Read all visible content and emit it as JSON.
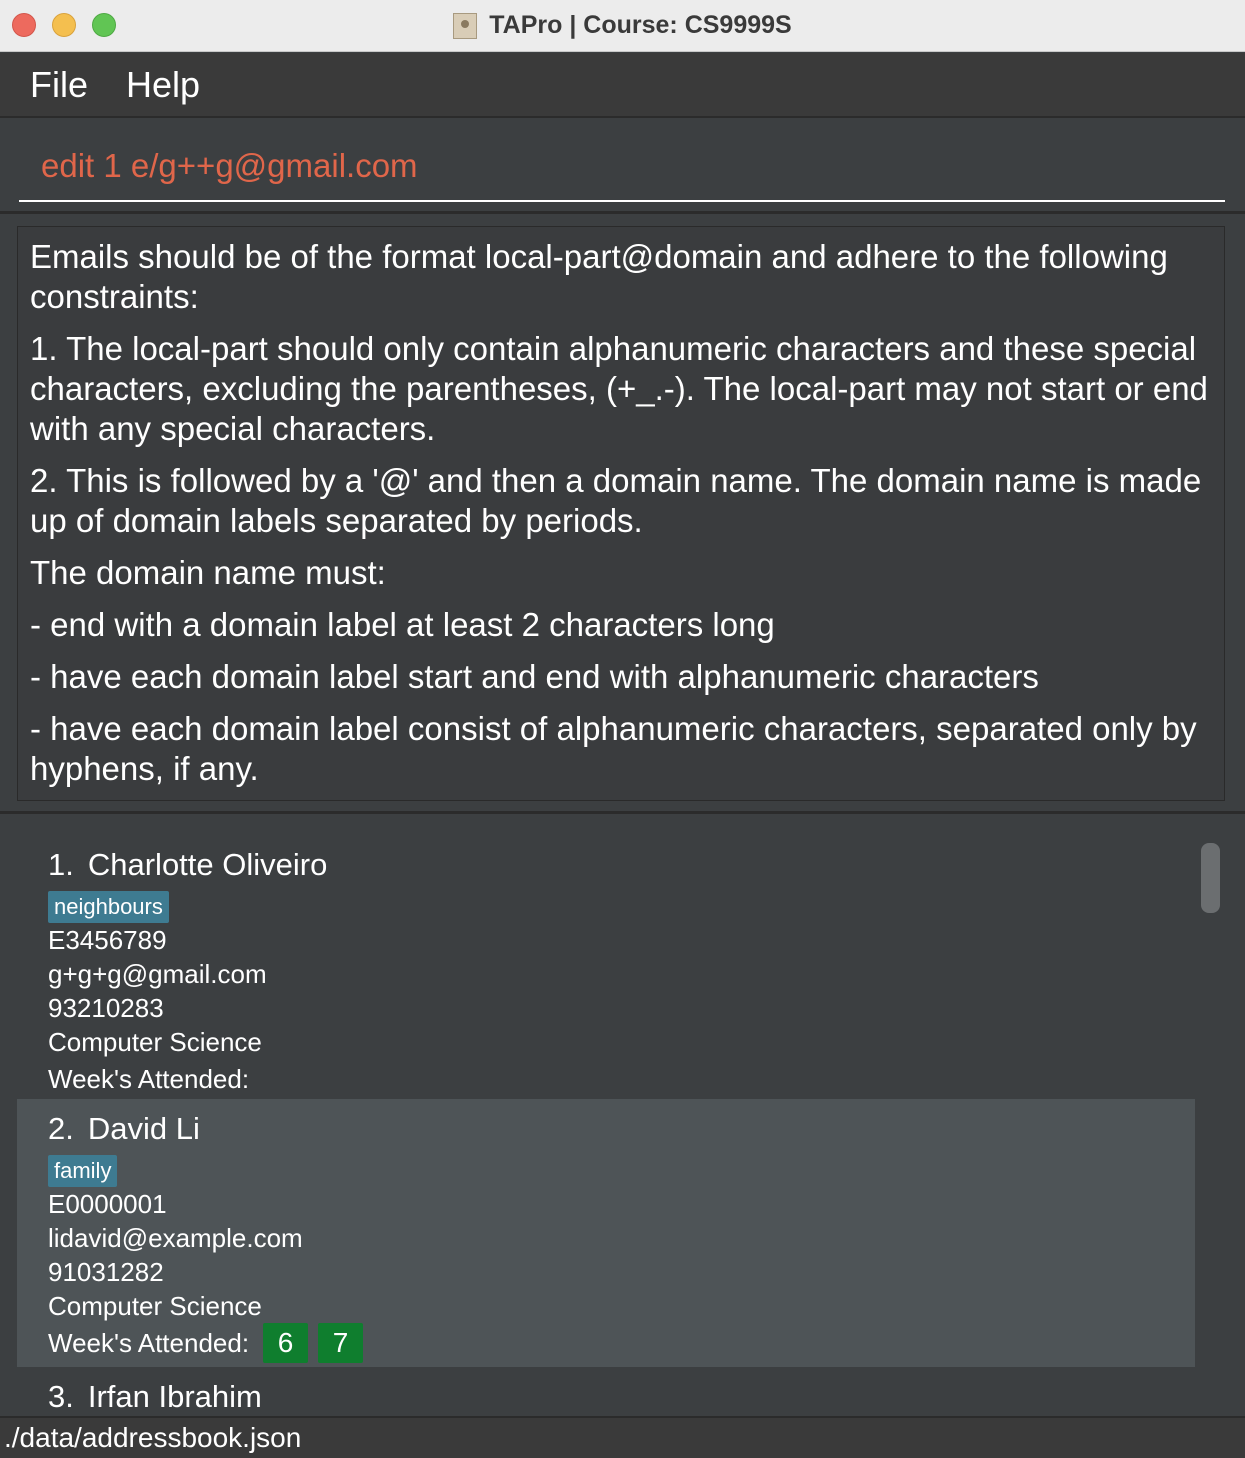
{
  "window": {
    "title": "TAPro | Course: CS9999S",
    "doc_icon": "contacts-book-icon"
  },
  "menu": {
    "file_label": "File",
    "help_label": "Help"
  },
  "command": {
    "value": "edit 1 e/g++g@gmail.com",
    "error_color": "#e0664a"
  },
  "result": {
    "lines": [
      "Emails should be of the format local-part@domain and adhere to the following constraints:",
      "1. The local-part should only contain alphanumeric characters and these special characters, excluding the parentheses, (+_.-). The local-part may not start or end with any special characters.",
      "2. This is followed by a '@' and then a domain name. The domain name is made up of domain labels separated by periods.",
      "The domain name must:",
      "- end with a domain label at least 2 characters long",
      "- have each domain label start and end with alphanumeric characters",
      "- have each domain label consist of alphanumeric characters, separated only by hyphens, if any."
    ]
  },
  "persons": [
    {
      "index": "1.",
      "name": "Charlotte Oliveiro",
      "tag": "neighbours",
      "student_id": "E3456789",
      "email": "g+g+g@gmail.com",
      "phone": "93210283",
      "major": "Computer Science",
      "weeks_label": "Week's Attended:",
      "weeks": []
    },
    {
      "index": "2.",
      "name": "David Li",
      "tag": "family",
      "student_id": "E0000001",
      "email": "lidavid@example.com",
      "phone": "91031282",
      "major": "Computer Science",
      "weeks_label": "Week's Attended:",
      "weeks": [
        "6",
        "7"
      ]
    },
    {
      "index": "3.",
      "name": "Irfan Ibrahim"
    }
  ],
  "status": {
    "path": "./data/addressbook.json"
  },
  "colors": {
    "tag_bg": "#3e7b91",
    "week_badge_bg": "#0f7e2e",
    "selected_card_bg": "#4e5457"
  }
}
